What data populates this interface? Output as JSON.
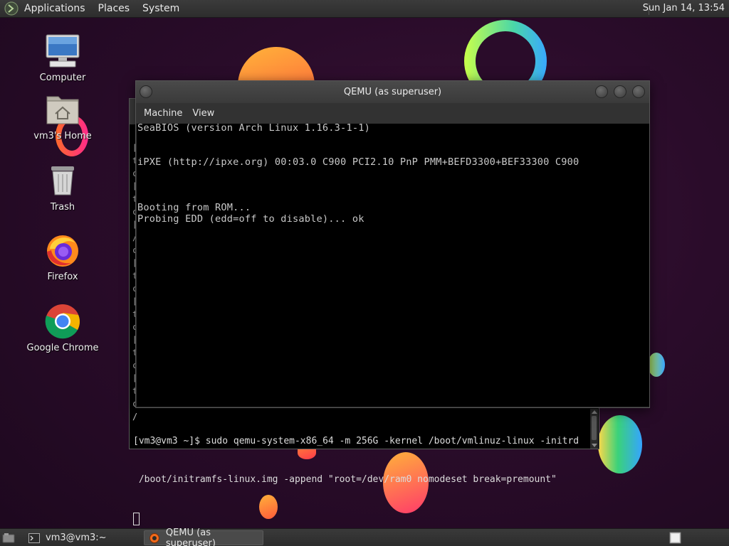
{
  "top_panel": {
    "menus": [
      "Applications",
      "Places",
      "System"
    ],
    "clock": "Sun Jan 14, 13:54"
  },
  "desktop_icons": [
    {
      "label": "Computer",
      "icon": "computer-icon"
    },
    {
      "label": "vm3's Home",
      "icon": "home-folder-icon"
    },
    {
      "label": "Trash",
      "icon": "trash-icon"
    },
    {
      "label": "Firefox",
      "icon": "firefox-icon"
    },
    {
      "label": "Google Chrome",
      "icon": "chrome-icon"
    }
  ],
  "qemu_window": {
    "title": "QEMU (as superuser)",
    "menus": [
      "Machine",
      "View"
    ],
    "console_lines": [
      "SeaBIOS (version Arch Linux 1.16.3-1-1)",
      "iPXE (http://ipxe.org) 00:03.0 C900 PCI2.10 PnP PMM+BEFD3300+BEF33300 C900",
      "Booting from ROM...",
      "Probing EDD (edd=off to disable)... ok"
    ]
  },
  "terminal": {
    "left_fragments": [
      "[",
      "t",
      "c",
      "[",
      "t",
      "c",
      "[",
      "/",
      "c",
      "[",
      "t",
      "c",
      "[",
      "t",
      "c",
      "[",
      "t",
      "c",
      "[",
      "t",
      "c",
      "/"
    ],
    "command_line_1": "[vm3@vm3 ~]$ sudo qemu-system-x86_64 -m 256G -kernel /boot/vmlinuz-linux -initrd",
    "command_line_2": " /boot/initramfs-linux.img -append \"root=/dev/ram0 nomodeset break=premount\""
  },
  "taskbar": {
    "tasks": [
      {
        "label": "vm3@vm3:~",
        "icon": "terminal-icon",
        "active": false
      },
      {
        "label": "QEMU (as superuser)",
        "icon": "qemu-icon",
        "active": true
      }
    ]
  }
}
